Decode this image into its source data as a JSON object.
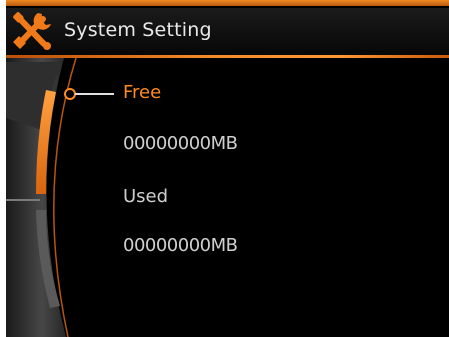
{
  "title": "System Setting",
  "items": [
    {
      "label": "Free",
      "value": "00000000MB",
      "selected": true
    },
    {
      "label": "Used",
      "value": "00000000MB",
      "selected": false
    }
  ],
  "colors": {
    "accent": "#ff8a1f",
    "accent_dark": "#c75b0e",
    "text": "#cfcfcf",
    "background": "#000000"
  },
  "icons": {
    "title": "tools-icon",
    "pointer": "selection-pointer-icon"
  }
}
